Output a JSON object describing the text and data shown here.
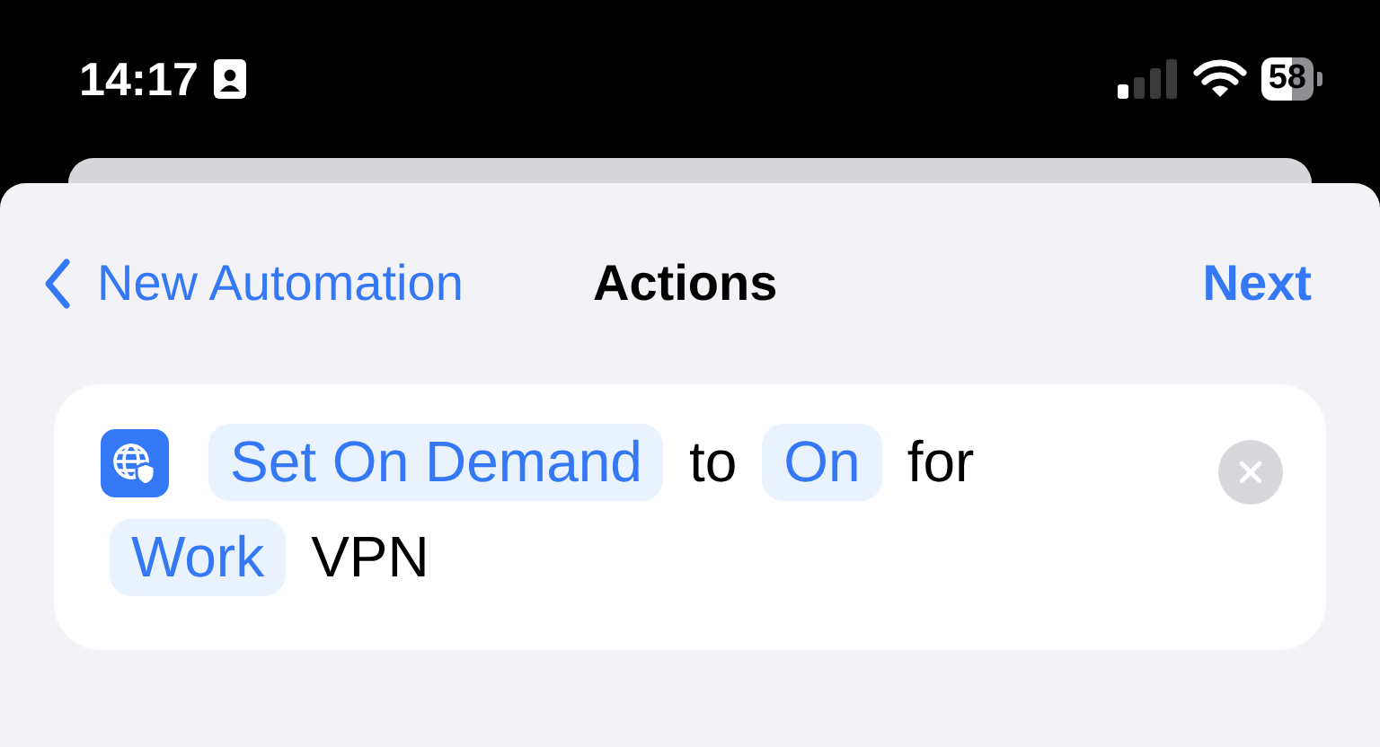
{
  "status_bar": {
    "time": "14:17",
    "battery": "58"
  },
  "nav": {
    "back": "New Automation",
    "title": "Actions",
    "next": "Next"
  },
  "action": {
    "lines": [
      [
        {
          "kind": "token",
          "text": "Set On Demand"
        },
        {
          "kind": "text",
          "text": "to"
        },
        {
          "kind": "token",
          "text": "On"
        },
        {
          "kind": "text",
          "text": "for"
        }
      ],
      [
        {
          "kind": "token",
          "text": "Work"
        },
        {
          "kind": "text",
          "text": "VPN"
        }
      ]
    ]
  }
}
